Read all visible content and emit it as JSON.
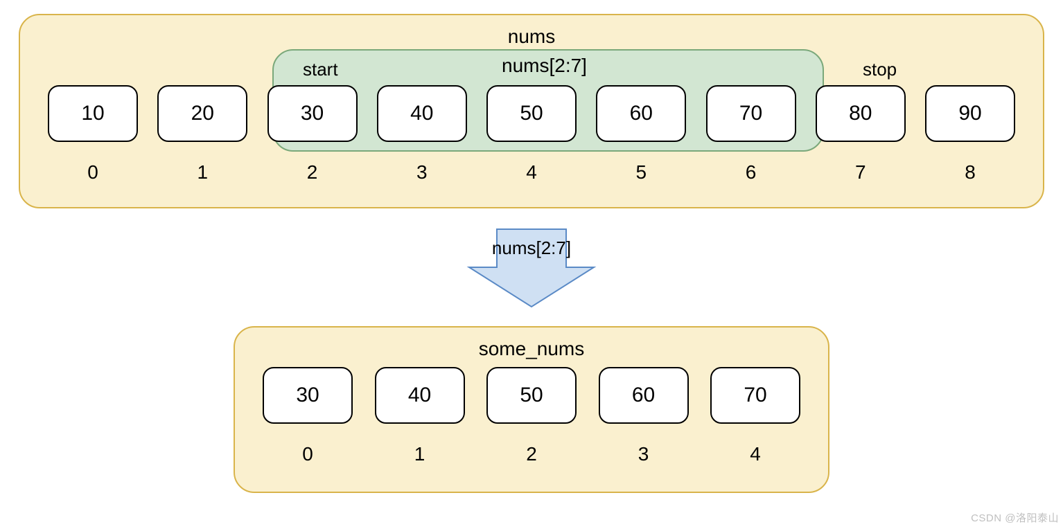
{
  "nums": {
    "title": "nums",
    "cells": [
      {
        "value": "10",
        "index": "0"
      },
      {
        "value": "20",
        "index": "1"
      },
      {
        "value": "30",
        "index": "2"
      },
      {
        "value": "40",
        "index": "3"
      },
      {
        "value": "50",
        "index": "4"
      },
      {
        "value": "60",
        "index": "5"
      },
      {
        "value": "70",
        "index": "6"
      },
      {
        "value": "80",
        "index": "7"
      },
      {
        "value": "90",
        "index": "8"
      }
    ],
    "slice_label": "nums[2:7]",
    "start_label": "start",
    "stop_label": "stop"
  },
  "arrow": {
    "label": "nums[2:7]"
  },
  "some_nums": {
    "title": "some_nums",
    "cells": [
      {
        "value": "30",
        "index": "0"
      },
      {
        "value": "40",
        "index": "1"
      },
      {
        "value": "50",
        "index": "2"
      },
      {
        "value": "60",
        "index": "3"
      },
      {
        "value": "70",
        "index": "4"
      }
    ]
  },
  "watermark": "CSDN @洛阳泰山"
}
